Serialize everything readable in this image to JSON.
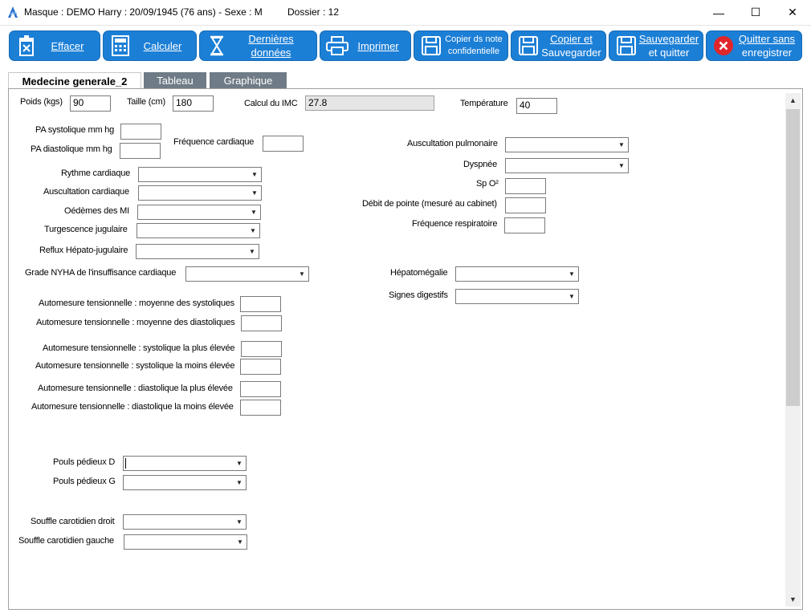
{
  "window": {
    "title": "Masque : DEMO Harry : 20/09/1945 (76 ans) - Sexe : M",
    "dossier": "Dossier : 12",
    "controls": {
      "minimize": "—",
      "maximize": "☐",
      "close": "✕"
    }
  },
  "toolbar": {
    "effacer": "Effacer",
    "calculer": "Calculer",
    "dernieres_1": "Dernières",
    "dernieres_2": "données",
    "imprimer": "Imprimer",
    "copier_note_1": "Copier ds note",
    "copier_note_2": "confidentielle",
    "copier_sauv_1": "Copier et",
    "copier_sauv_2": "Sauvegarder",
    "sauv_quit_1": "Sauvegarder",
    "sauv_quit_2": "et quitter",
    "quitter_1": "Quitter sans",
    "quitter_2": "enregistrer"
  },
  "tabs": [
    "Medecine generale_2",
    "Tableau",
    "Graphique"
  ],
  "form": {
    "poids_label": "Poids (kgs)",
    "poids_value": "90",
    "taille_label": "Taille (cm)",
    "taille_value": "180",
    "imc_label": "Calcul du IMC",
    "imc_value": "27.8",
    "temperature_label": "Température",
    "temperature_value": "40",
    "pa_sys_label": "PA systolique mm hg",
    "pa_dia_label": "PA diastolique mm hg",
    "freq_card_label": "Fréquence cardiaque",
    "ausc_pulm_label": "Auscultation pulmonaire",
    "dyspnee_label": "Dyspnée",
    "spo2_label": "Sp O²",
    "debit_label": "Débit de pointe (mesuré au cabinet)",
    "freq_resp_label": "Fréquence respiratoire",
    "rythme_label": "Rythme cardiaque",
    "ausc_card_label": "Auscultation cardiaque",
    "oedemes_label": "Oédèmes des MI",
    "turgescence_label": "Turgescence jugulaire",
    "reflux_label": "Reflux Hépato-jugulaire",
    "nyha_label": "Grade NYHA de l'insuffisance cardiaque",
    "hepato_label": "Hépatomégalie",
    "signes_dig_label": "Signes digestifs",
    "auto_moy_sys_label": "Automesure tensionnelle : moyenne des systoliques",
    "auto_moy_dia_label": "Automesure tensionnelle : moyenne des diastoliques",
    "auto_sys_haut_label": "Automesure tensionnelle : systolique la plus élevée",
    "auto_sys_bas_label": "Automesure tensionnelle : systolique la moins élevée",
    "auto_dia_haut_label": "Automesure tensionnelle : diastolique la plus élevée",
    "auto_dia_bas_label": "Automesure tensionnelle : diastolique la moins élevée",
    "pouls_d_label": "Pouls pédieux D",
    "pouls_g_label": "Pouls pédieux G",
    "souffle_d_label": "Souffle carotidien droit",
    "souffle_g_label": "Souffle carotidien gauche"
  },
  "colors": {
    "toolbar_button": "#1c7fd6",
    "tab_inactive": "#6f7b86",
    "quit_icon": "#e0262b"
  }
}
